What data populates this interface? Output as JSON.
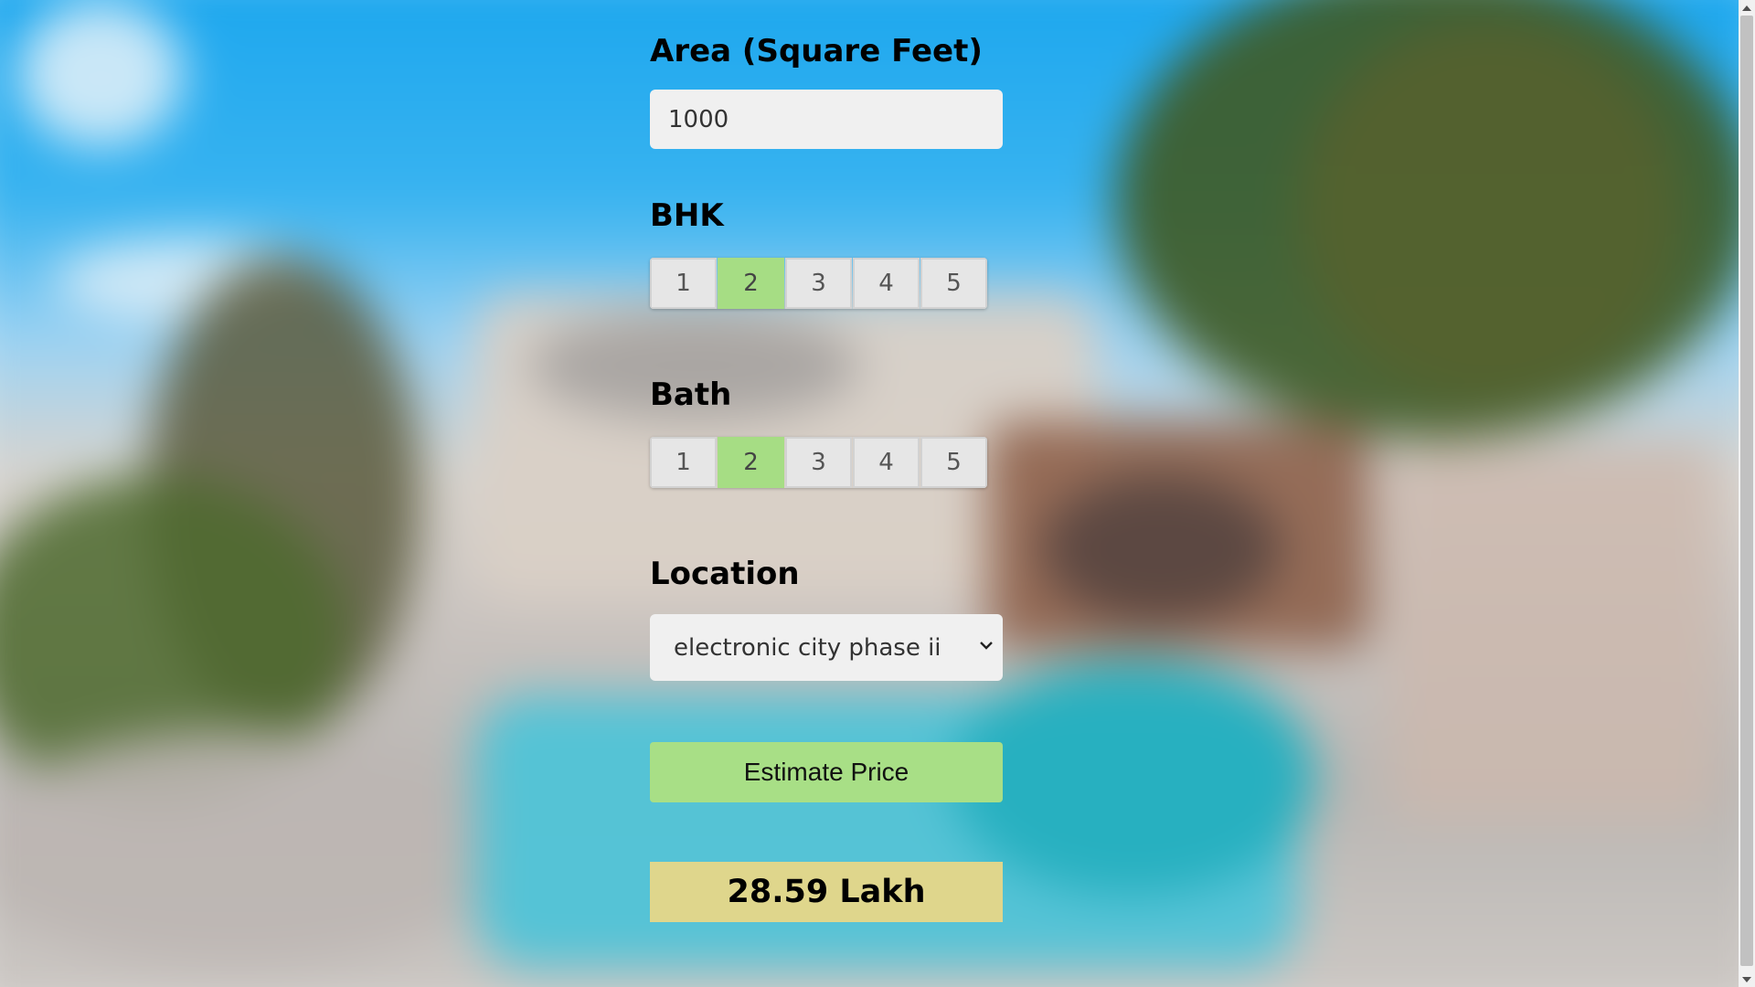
{
  "form": {
    "area_label": "Area (Square Feet)",
    "area_value": "1000",
    "bhk_label": "BHK",
    "bhk_options": [
      "1",
      "2",
      "3",
      "4",
      "5"
    ],
    "bhk_selected": "2",
    "bath_label": "Bath",
    "bath_options": [
      "1",
      "2",
      "3",
      "4",
      "5"
    ],
    "bath_selected": "2",
    "location_label": "Location",
    "location_value": "electronic city phase ii",
    "estimate_label": "Estimate Price",
    "result_text": "28.59 Lakh"
  },
  "colors": {
    "selected_option": "#a6dd84",
    "estimate_button": "#a8df86",
    "result_box": "#dfd68c"
  },
  "icons": {
    "dropdown": "chevron-down-icon",
    "scroll_up": "triangle-up-icon",
    "scroll_down": "triangle-down-icon"
  }
}
